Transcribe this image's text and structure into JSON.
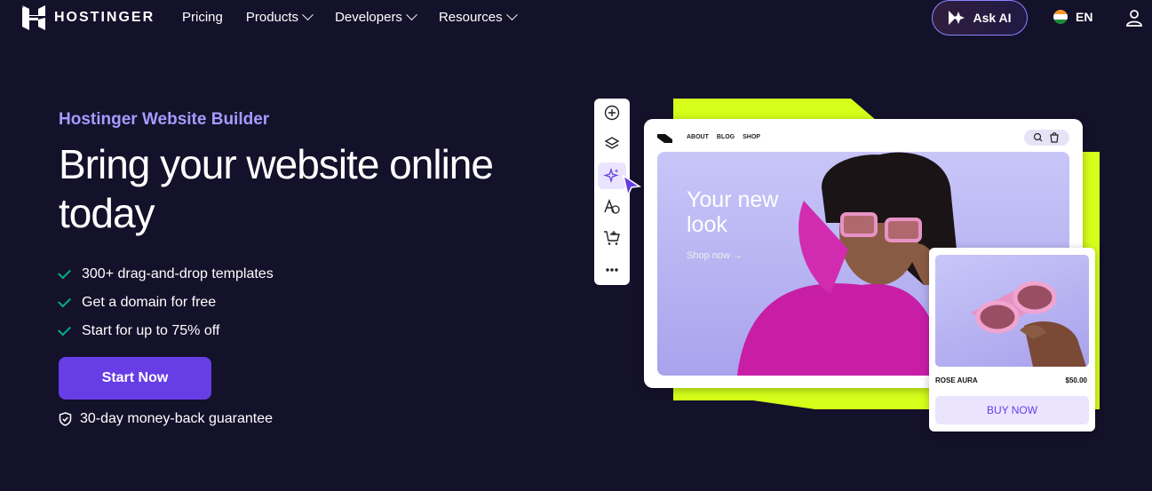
{
  "nav": {
    "brand": "HOSTINGER",
    "links": [
      {
        "label": "Pricing",
        "dropdown": false
      },
      {
        "label": "Products",
        "dropdown": true
      },
      {
        "label": "Developers",
        "dropdown": true
      },
      {
        "label": "Resources",
        "dropdown": true
      }
    ],
    "ask_ai": "Ask AI",
    "language": "EN"
  },
  "hero": {
    "eyebrow": "Hostinger Website Builder",
    "headline": "Bring your website online today",
    "features": [
      "300+ drag-and-drop templates",
      "Get a domain for free",
      "Start for up to 75% off"
    ],
    "cta": "Start Now",
    "guarantee": "30-day money-back guarantee"
  },
  "builder": {
    "tools": [
      "add-icon",
      "layers-icon",
      "ai-sparkle-icon",
      "typography-icon",
      "cart-icon",
      "more-icon"
    ],
    "site_nav": [
      "ABOUT",
      "BLOG",
      "SHOP"
    ],
    "site_hero_title": "Your new look",
    "site_hero_link": "Shop now →",
    "product_name": "ROSE AURA",
    "product_price": "$50.00",
    "buy_label": "BUY NOW"
  },
  "colors": {
    "background": "#14112a",
    "accent": "#673de6",
    "eyebrow": "#a69bff",
    "check": "#00b090",
    "lime": "#d6ff1a"
  }
}
